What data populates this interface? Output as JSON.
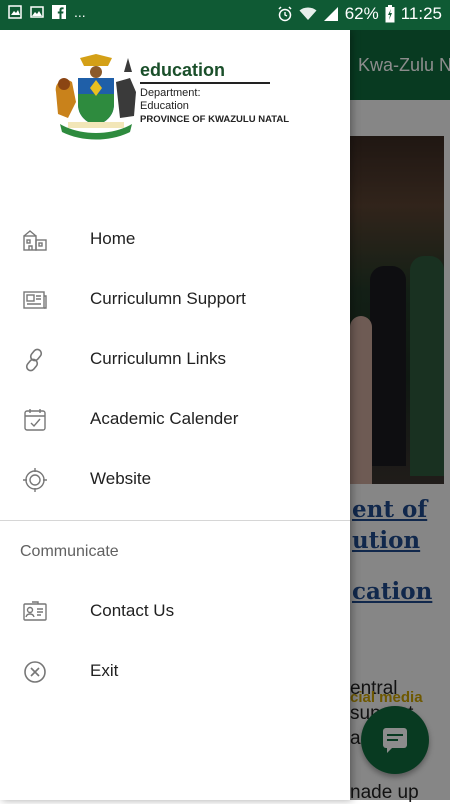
{
  "status_bar": {
    "battery": "62%",
    "time": "11:25",
    "more": "..."
  },
  "background": {
    "title": "Kwa-Zulu N",
    "heading_lines": [
      "ent of",
      "ution",
      "cation"
    ],
    "body_lines": [
      "entral",
      "support",
      "an",
      "nade up"
    ],
    "social_label": "cial media"
  },
  "drawer": {
    "logo": {
      "wordmark": "education",
      "department": "Department:",
      "subline": "Education",
      "province": "PROVINCE OF KWAZULU NATAL"
    },
    "items": [
      {
        "label": "Home",
        "icon": "home-building-icon"
      },
      {
        "label": "Curriculumn Support",
        "icon": "newspaper-icon"
      },
      {
        "label": "Curriculumn Links",
        "icon": "link-icon"
      },
      {
        "label": "Academic Calender",
        "icon": "calendar-icon"
      },
      {
        "label": "Website",
        "icon": "web-target-icon"
      }
    ],
    "section_title": "Communicate",
    "communicate_items": [
      {
        "label": "Contact Us",
        "icon": "contact-card-icon"
      },
      {
        "label": "Exit",
        "icon": "close-circle-icon"
      }
    ]
  },
  "colors": {
    "primary": "#0f6b3d",
    "status": "#0f5a34",
    "heading_link": "#1f4a8a",
    "social": "#c8a000"
  }
}
